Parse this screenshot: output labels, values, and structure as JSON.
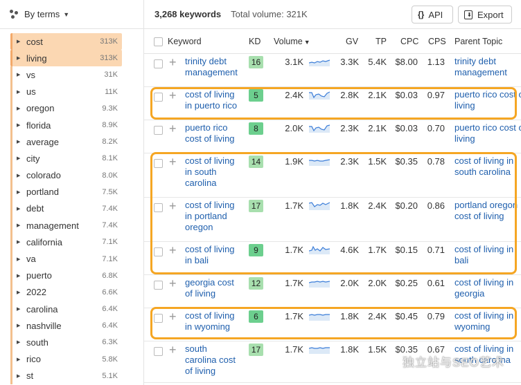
{
  "sidebar": {
    "title": "By terms",
    "items": [
      {
        "term": "cost",
        "count": "313K",
        "active": true
      },
      {
        "term": "living",
        "count": "313K",
        "active": true
      },
      {
        "term": "vs",
        "count": "31K"
      },
      {
        "term": "us",
        "count": "11K"
      },
      {
        "term": "oregon",
        "count": "9.3K"
      },
      {
        "term": "florida",
        "count": "8.9K"
      },
      {
        "term": "average",
        "count": "8.2K"
      },
      {
        "term": "city",
        "count": "8.1K"
      },
      {
        "term": "colorado",
        "count": "8.0K"
      },
      {
        "term": "portland",
        "count": "7.5K"
      },
      {
        "term": "debt",
        "count": "7.4K"
      },
      {
        "term": "management",
        "count": "7.4K"
      },
      {
        "term": "california",
        "count": "7.1K"
      },
      {
        "term": "va",
        "count": "7.1K"
      },
      {
        "term": "puerto",
        "count": "6.8K"
      },
      {
        "term": "2022",
        "count": "6.6K"
      },
      {
        "term": "carolina",
        "count": "6.4K"
      },
      {
        "term": "nashville",
        "count": "6.4K"
      },
      {
        "term": "south",
        "count": "6.3K"
      },
      {
        "term": "rico",
        "count": "5.8K"
      },
      {
        "term": "st",
        "count": "5.1K"
      }
    ]
  },
  "header": {
    "keywords_count": "3,268 keywords",
    "total_volume": "Total volume: 321K",
    "api_label": "API",
    "export_label": "Export"
  },
  "table": {
    "columns": {
      "keyword": "Keyword",
      "kd": "KD",
      "volume": "Volume",
      "gv": "GV",
      "tp": "TP",
      "cpc": "CPC",
      "cps": "CPS",
      "parent_topic": "Parent Topic"
    },
    "rows": [
      {
        "kw": [
          "trinity debt",
          "management"
        ],
        "kd": "16",
        "vol": "3.1K",
        "gv": "3.3K",
        "tp": "5.4K",
        "cpc": "$8.00",
        "cps": "1.13",
        "pt": [
          "trinity debt",
          "management"
        ]
      },
      {
        "kw": [
          "cost of living",
          "in puerto rico"
        ],
        "kd": "5",
        "vol": "2.4K",
        "gv": "2.8K",
        "tp": "2.1K",
        "cpc": "$0.03",
        "cps": "0.97",
        "pt": [
          "puerto rico cost o",
          "living"
        ]
      },
      {
        "kw": [
          "puerto rico",
          "cost of living"
        ],
        "kd": "8",
        "vol": "2.0K",
        "gv": "2.3K",
        "tp": "2.1K",
        "cpc": "$0.03",
        "cps": "0.70",
        "pt": [
          "puerto rico cost o",
          "living"
        ]
      },
      {
        "kw": [
          "cost of living",
          "in south",
          "carolina"
        ],
        "kd": "14",
        "vol": "1.9K",
        "gv": "2.3K",
        "tp": "1.5K",
        "cpc": "$0.35",
        "cps": "0.78",
        "pt": [
          "cost of living in",
          "south carolina"
        ]
      },
      {
        "kw": [
          "cost of living",
          "in portland",
          "oregon"
        ],
        "kd": "17",
        "vol": "1.7K",
        "gv": "1.8K",
        "tp": "2.4K",
        "cpc": "$0.20",
        "cps": "0.86",
        "pt": [
          "portland oregon",
          "cost of living"
        ]
      },
      {
        "kw": [
          "cost of living",
          "in bali"
        ],
        "kd": "9",
        "vol": "1.7K",
        "gv": "4.6K",
        "tp": "1.7K",
        "cpc": "$0.15",
        "cps": "0.71",
        "pt": [
          "cost of living in",
          "bali"
        ]
      },
      {
        "kw": [
          "georgia cost",
          "of living"
        ],
        "kd": "12",
        "vol": "1.7K",
        "gv": "2.0K",
        "tp": "2.0K",
        "cpc": "$0.25",
        "cps": "0.61",
        "pt": [
          "cost of living in",
          "georgia"
        ]
      },
      {
        "kw": [
          "cost of living",
          "in wyoming"
        ],
        "kd": "6",
        "vol": "1.7K",
        "gv": "1.8K",
        "tp": "2.4K",
        "cpc": "$0.45",
        "cps": "0.79",
        "pt": [
          "cost of living in",
          "wyoming"
        ]
      },
      {
        "kw": [
          "south",
          "carolina cost",
          "of living"
        ],
        "kd": "17",
        "vol": "1.7K",
        "gv": "1.8K",
        "tp": "1.5K",
        "cpc": "$0.35",
        "cps": "0.67",
        "pt": [
          "cost of living in",
          "south carolina"
        ]
      }
    ]
  },
  "watermark": "独立站与SEO艺术",
  "colors": {
    "kd_low": "#6ccf8e",
    "kd_mid": "#a8dfae",
    "link": "#1f5fad",
    "highlight": "#f5a623",
    "active_term": "#fbd7b2"
  }
}
